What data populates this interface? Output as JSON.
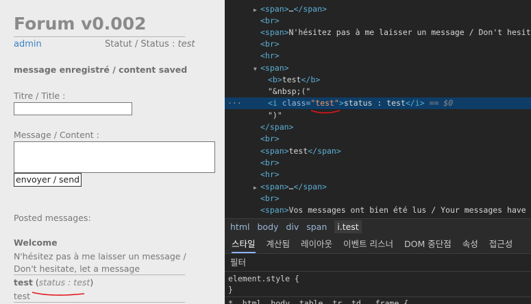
{
  "page": {
    "title": "Forum v0.002",
    "user_link": "admin",
    "status_prefix": "Statut / Status : ",
    "status_value": "test",
    "saved_msg": "message enregistré / content saved",
    "title_label": "Titre / Title :",
    "message_label": "Message / Content :",
    "send_label": "envoyer / send",
    "posted_heading": "Posted messages:",
    "posts": [
      {
        "author": "Welcome",
        "message": "N'hésitez pas à me laisser un message / Don't hesitate, let a message"
      },
      {
        "author": "test",
        "status_open": " (",
        "status_label": "status : test",
        "status_close": ")",
        "message": "test"
      }
    ]
  },
  "devtools": {
    "dom": {
      "r0": {
        "open": "<span>",
        "ellipsis": "…",
        "close": "</span>"
      },
      "r1": "<br>",
      "r2": {
        "open": "<span>",
        "text": "N'hésitez pas à me laisser un message / Don't hesitate, let a message"
      },
      "r3": "<br>",
      "r4": "<hr>",
      "r5": "<span>",
      "r6": {
        "open": "<b>",
        "text": "test",
        "close": "</b>"
      },
      "r7": "\"&nbsp;(\"",
      "r8": {
        "open": "<i",
        "attr": "class=",
        "val": "\"test\"",
        "gt": ">",
        "text": "status : test",
        "close": "</i>",
        "eq": "==",
        "dollar": "$0"
      },
      "r9": "\")\"",
      "r10": "</span>",
      "r11": "<br>",
      "r12": {
        "open": "<span>",
        "text": "test",
        "close": "</span>"
      },
      "r13": "<br>",
      "r14": "<hr>",
      "r15": {
        "open": "<span>",
        "ellipsis": "…",
        "close": "</span>"
      },
      "r16": "<br>",
      "r17": {
        "open": "<span>",
        "text": "Vos messages ont bien été lus / Your messages have been read"
      },
      "row_menu": "···"
    },
    "breadcrumbs": [
      "html",
      "body",
      "div",
      "span",
      "i.test"
    ],
    "tabs": [
      "스타일",
      "계산됨",
      "레이아웃",
      "이벤트 리스너",
      "DOM 중단점",
      "속성",
      "접근성"
    ],
    "filter_label": "필터",
    "styles": {
      "rule1_selector": "element.style {",
      "rule1_close": "}",
      "rule2": "*, html, body, table, tr, td, .frame {"
    },
    "colors": {
      "accent_red": "#e0161b",
      "selection": "#0e3e67"
    }
  }
}
